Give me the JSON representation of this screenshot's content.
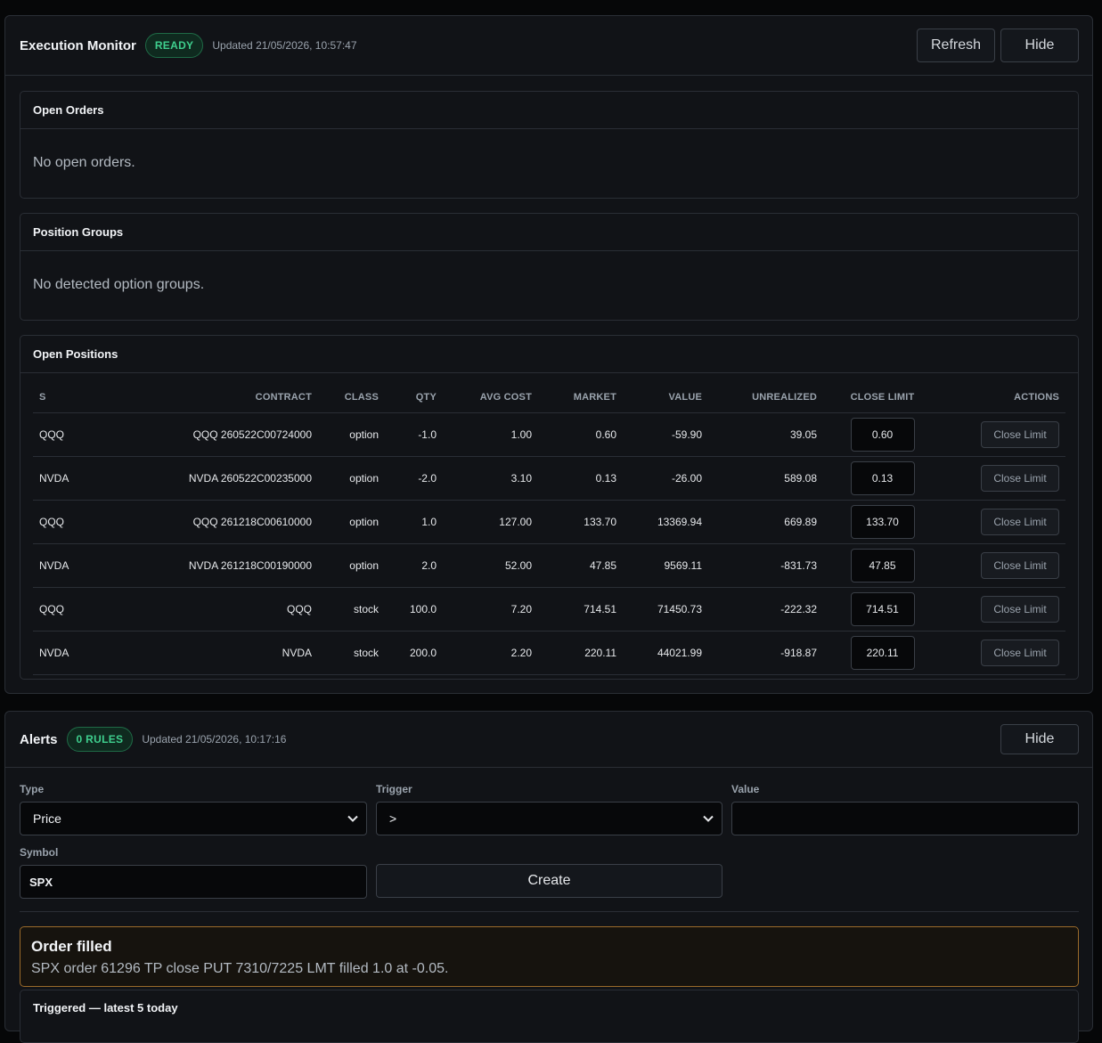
{
  "execution_monitor": {
    "title": "Execution Monitor",
    "status_badge": "READY",
    "updated": "Updated 21/05/2026, 10:57:47",
    "refresh_label": "Refresh",
    "hide_label": "Hide",
    "open_orders": {
      "title": "Open Orders",
      "empty_text": "No open orders."
    },
    "position_groups": {
      "title": "Position Groups",
      "empty_text": "No detected option groups."
    },
    "open_positions": {
      "title": "Open Positions",
      "columns": [
        "S",
        "CONTRACT",
        "CLASS",
        "QTY",
        "AVG COST",
        "MARKET",
        "VALUE",
        "UNREALIZED",
        "CLOSE LIMIT",
        "ACTIONS"
      ],
      "action_label": "Close Limit",
      "rows": [
        {
          "symbol": "QQQ",
          "contract": "QQQ 260522C00724000",
          "class": "option",
          "qty": "-1.0",
          "avg_cost": "1.00",
          "market": "0.60",
          "value": "-59.90",
          "unrealized": "39.05",
          "close_limit": "0.60"
        },
        {
          "symbol": "NVDA",
          "contract": "NVDA 260522C00235000",
          "class": "option",
          "qty": "-2.0",
          "avg_cost": "3.10",
          "market": "0.13",
          "value": "-26.00",
          "unrealized": "589.08",
          "close_limit": "0.13"
        },
        {
          "symbol": "QQQ",
          "contract": "QQQ 261218C00610000",
          "class": "option",
          "qty": "1.0",
          "avg_cost": "127.00",
          "market": "133.70",
          "value": "13369.94",
          "unrealized": "669.89",
          "close_limit": "133.70"
        },
        {
          "symbol": "NVDA",
          "contract": "NVDA 261218C00190000",
          "class": "option",
          "qty": "2.0",
          "avg_cost": "52.00",
          "market": "47.85",
          "value": "9569.11",
          "unrealized": "-831.73",
          "close_limit": "47.85"
        },
        {
          "symbol": "QQQ",
          "contract": "QQQ",
          "class": "stock",
          "qty": "100.0",
          "avg_cost": "7.20",
          "market": "714.51",
          "value": "71450.73",
          "unrealized": "-222.32",
          "close_limit": "714.51"
        },
        {
          "symbol": "NVDA",
          "contract": "NVDA",
          "class": "stock",
          "qty": "200.0",
          "avg_cost": "2.20",
          "market": "220.11",
          "value": "44021.99",
          "unrealized": "-918.87",
          "close_limit": "220.11"
        }
      ]
    }
  },
  "alerts": {
    "title": "Alerts",
    "rules_badge": "0 RULES",
    "updated": "Updated 21/05/2026, 10:17:16",
    "hide_label": "Hide",
    "form": {
      "type_label": "Type",
      "type_value": "Price",
      "trigger_label": "Trigger",
      "trigger_value": ">",
      "value_label": "Value",
      "value_value": "",
      "symbol_label": "Symbol",
      "symbol_value": "SPX",
      "create_label": "Create"
    },
    "notice": {
      "title": "Order filled",
      "message": "SPX order 61296 TP close PUT 7310/7225 LMT filled 1.0 at -0.05."
    },
    "triggered_title": "Triggered — latest 5 today"
  }
}
